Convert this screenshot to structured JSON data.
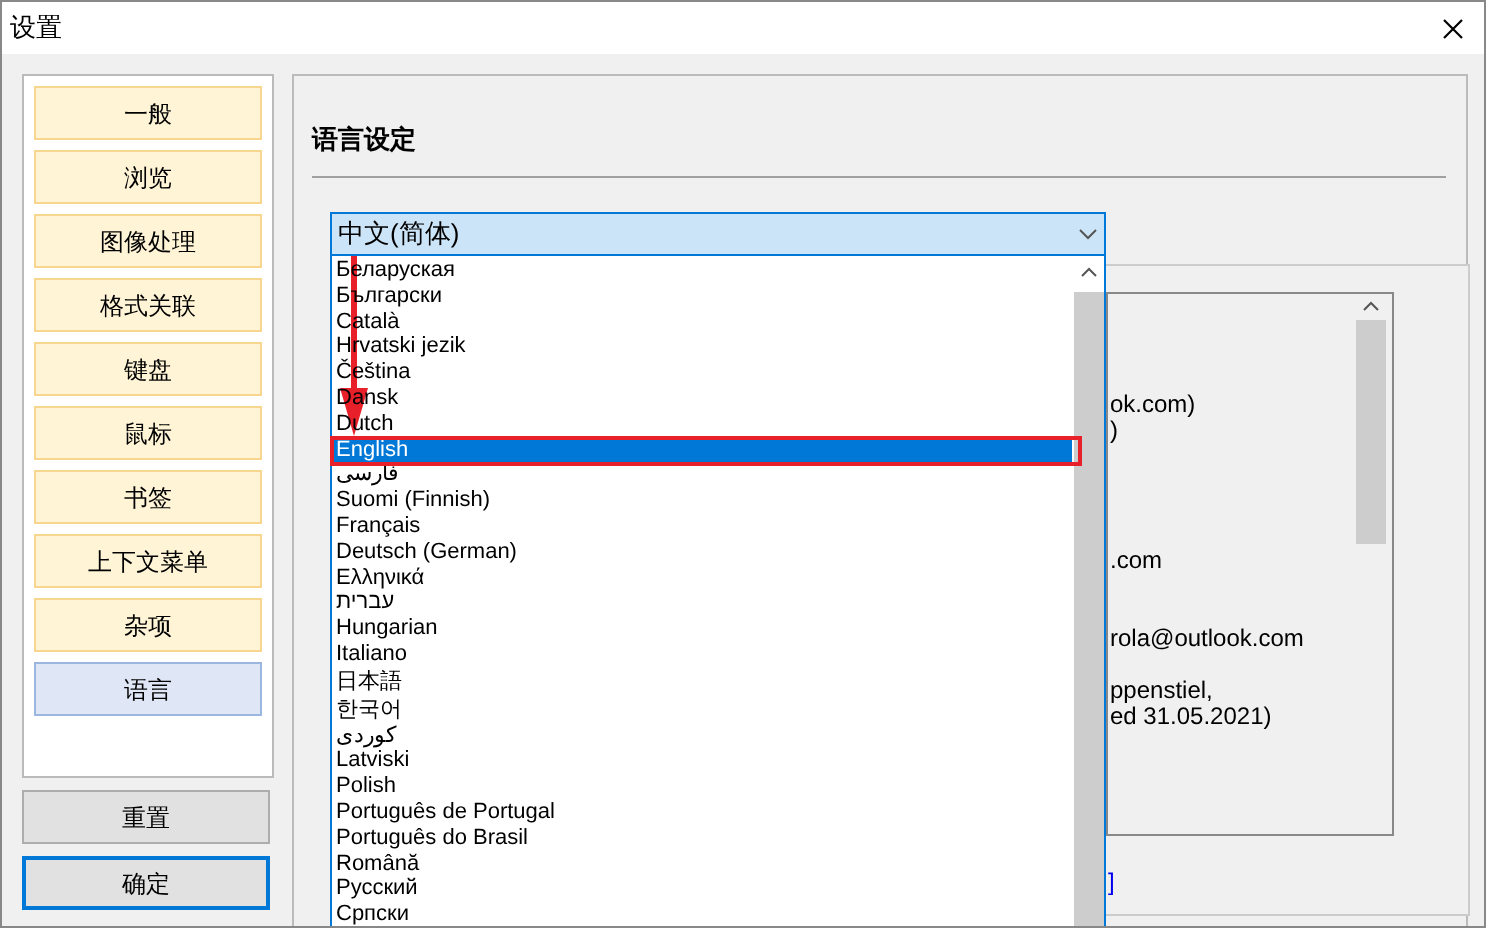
{
  "window": {
    "title": "设置"
  },
  "nav": [
    {
      "label": "一般",
      "selected": false
    },
    {
      "label": "浏览",
      "selected": false
    },
    {
      "label": "图像处理",
      "selected": false
    },
    {
      "label": "格式关联",
      "selected": false
    },
    {
      "label": "键盘",
      "selected": false
    },
    {
      "label": "鼠标",
      "selected": false
    },
    {
      "label": "书签",
      "selected": false
    },
    {
      "label": "上下文菜单",
      "selected": false
    },
    {
      "label": "杂项",
      "selected": false
    },
    {
      "label": "语言",
      "selected": true
    }
  ],
  "buttons": [
    {
      "label": "重置",
      "default": false
    },
    {
      "label": "确定",
      "default": true
    }
  ],
  "section_title": "语言设定",
  "language_select": {
    "value": "中文(简体)",
    "options": [
      {
        "label": "Беларуская",
        "selected": false
      },
      {
        "label": "Български",
        "selected": false
      },
      {
        "label": "Català",
        "selected": false
      },
      {
        "label": "Hrvatski jezik",
        "selected": false
      },
      {
        "label": "Čeština",
        "selected": false
      },
      {
        "label": "Dansk",
        "selected": false
      },
      {
        "label": "Dutch",
        "selected": false
      },
      {
        "label": "English",
        "selected": true
      },
      {
        "label": "فارسی",
        "selected": false
      },
      {
        "label": "Suomi (Finnish)",
        "selected": false
      },
      {
        "label": "Français",
        "selected": false
      },
      {
        "label": "Deutsch (German)",
        "selected": false
      },
      {
        "label": "Ελληνικά",
        "selected": false
      },
      {
        "label": "עברית",
        "selected": false
      },
      {
        "label": "Hungarian",
        "selected": false
      },
      {
        "label": "Italiano",
        "selected": false
      },
      {
        "label": "日本語",
        "selected": false
      },
      {
        "label": "한국어",
        "selected": false
      },
      {
        "label": "کوردی",
        "selected": false
      },
      {
        "label": "Latviski",
        "selected": false
      },
      {
        "label": "Polish",
        "selected": false
      },
      {
        "label": "Português de Portugal",
        "selected": false
      },
      {
        "label": "Português do Brasil",
        "selected": false
      },
      {
        "label": "Română",
        "selected": false
      },
      {
        "label": "Русский",
        "selected": false
      },
      {
        "label": "Српски",
        "selected": false
      }
    ]
  },
  "background_texts": [
    "ok.com)",
    ")",
    ".com",
    "rola@outlook.com",
    "ppenstiel,",
    "ed 31.05.2021)"
  ],
  "background_link": "]"
}
